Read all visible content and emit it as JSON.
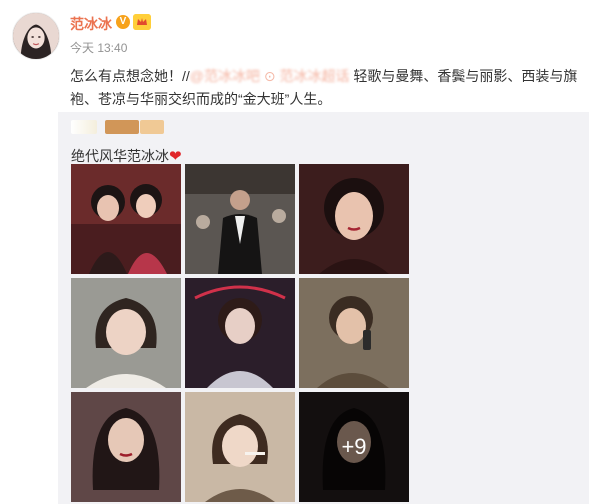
{
  "post": {
    "username": "范冰冰",
    "verified_badge": "V",
    "timestamp": "今天 13:40",
    "text_prefix": "怎么有点想念她！//",
    "mention_1": "@范冰冰吧",
    "mention_2": "范冰冰超话",
    "text_suffix": "轻歌与曼舞、香鬓与丽影、西装与旗袍、苍凉与华丽交织而成的“金大班”人生。"
  },
  "repost": {
    "text": "绝代风华范冰冰",
    "heart": "❤"
  },
  "grid": {
    "captions": [
      "",
      "",
      "",
      "",
      "",
      "",
      "",
      "",
      ""
    ],
    "more_count": "+9"
  },
  "colors": {
    "accent": "#eb7350",
    "repost_bg": "#f2f2f5",
    "timestamp": "#939393",
    "badge": "#f7a21b"
  }
}
